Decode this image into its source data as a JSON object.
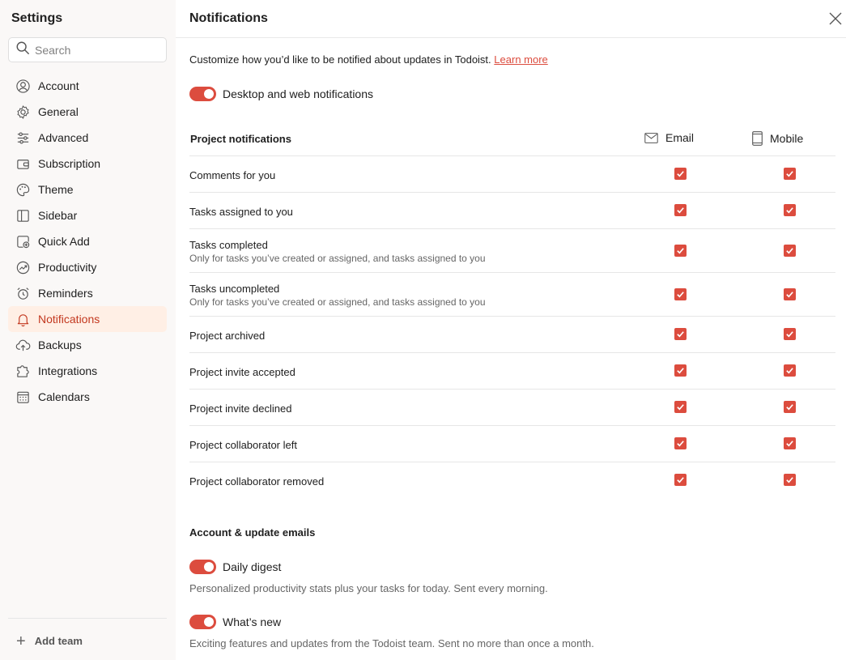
{
  "sidebar": {
    "title": "Settings",
    "search_placeholder": "Search",
    "items": [
      {
        "label": "Account",
        "icon": "account-icon"
      },
      {
        "label": "General",
        "icon": "gear-icon"
      },
      {
        "label": "Advanced",
        "icon": "sliders-icon"
      },
      {
        "label": "Subscription",
        "icon": "wallet-icon"
      },
      {
        "label": "Theme",
        "icon": "palette-icon"
      },
      {
        "label": "Sidebar",
        "icon": "sidebar-icon"
      },
      {
        "label": "Quick Add",
        "icon": "quick-add-icon"
      },
      {
        "label": "Productivity",
        "icon": "productivity-icon"
      },
      {
        "label": "Reminders",
        "icon": "alarm-icon"
      },
      {
        "label": "Notifications",
        "icon": "bell-icon",
        "active": true
      },
      {
        "label": "Backups",
        "icon": "cloud-upload-icon"
      },
      {
        "label": "Integrations",
        "icon": "puzzle-icon"
      },
      {
        "label": "Calendars",
        "icon": "calendar-icon"
      }
    ],
    "add_team": "Add team"
  },
  "header": {
    "title": "Notifications"
  },
  "intro": {
    "text": "Customize how you’d like to be notified about updates in Todoist.",
    "link": "Learn more"
  },
  "desktop_toggle": {
    "label": "Desktop and web notifications",
    "on": true
  },
  "project_notifications": {
    "title": "Project notifications",
    "email_label": "Email",
    "mobile_label": "Mobile",
    "rows": [
      {
        "label": "Comments for you",
        "sub": "",
        "email": true,
        "mobile": true
      },
      {
        "label": "Tasks assigned to you",
        "sub": "",
        "email": true,
        "mobile": true
      },
      {
        "label": "Tasks completed",
        "sub": "Only for tasks you’ve created or assigned, and tasks assigned to you",
        "email": true,
        "mobile": true
      },
      {
        "label": "Tasks uncompleted",
        "sub": "Only for tasks you’ve created or assigned, and tasks assigned to you",
        "email": true,
        "mobile": true
      },
      {
        "label": "Project archived",
        "sub": "",
        "email": true,
        "mobile": true
      },
      {
        "label": "Project invite accepted",
        "sub": "",
        "email": true,
        "mobile": true
      },
      {
        "label": "Project invite declined",
        "sub": "",
        "email": true,
        "mobile": true
      },
      {
        "label": "Project collaborator left",
        "sub": "",
        "email": true,
        "mobile": true
      },
      {
        "label": "Project collaborator removed",
        "sub": "",
        "email": true,
        "mobile": true
      }
    ]
  },
  "account_emails": {
    "title": "Account & update emails",
    "daily_digest": {
      "label": "Daily digest",
      "desc": "Personalized productivity stats plus your tasks for today. Sent every morning.",
      "on": true
    },
    "whats_new": {
      "label": "What’s new",
      "desc": "Exciting features and updates from the Todoist team. Sent no more than once a month.",
      "on": true
    }
  },
  "colors": {
    "accent": "#dc4c3e",
    "active_bg": "#ffefe5",
    "active_text": "#c3381f"
  }
}
